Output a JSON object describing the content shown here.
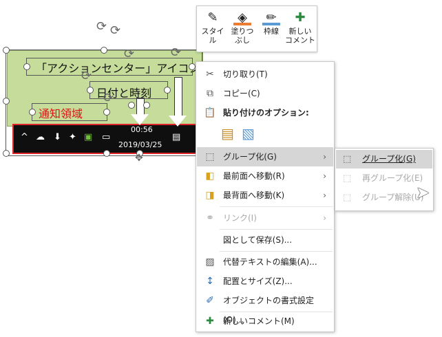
{
  "slide": {
    "action_center_label": "「アクションセンター」アイコン",
    "date_time_label": "日付と時刻",
    "notification_area_label": "通知領域",
    "taskbar_time": "00:56",
    "taskbar_date": "2019/03/25"
  },
  "mini_toolbar": {
    "style": "スタイル",
    "fill_line1": "塗りつ",
    "fill_line2": "ぶし",
    "outline": "枠線",
    "new_comment_line1": "新しい",
    "new_comment_line2": "コメント"
  },
  "menu": {
    "cut": "切り取り(T)",
    "copy": "コピー(C)",
    "paste_options": "貼り付けのオプション:",
    "group": "グループ化(G)",
    "bring_front": "最前面へ移動(R)",
    "send_back": "最背面へ移動(K)",
    "link": "リンク(I)",
    "save_as_picture": "図として保存(S)...",
    "alt_text": "代替テキストの編集(A)...",
    "size_position": "配置とサイズ(Z)...",
    "format_object": "オブジェクトの書式設定(O)...",
    "new_comment": "新しいコメント(M)"
  },
  "submenu": {
    "group": "グループ化(G)",
    "regroup": "再グループ化(E)",
    "ungroup": "グループ解除(U)"
  },
  "colors": {
    "slide_green": "#c5dc9a",
    "highlight": "#d6d6d6",
    "fill_orange": "#ed7d31",
    "outline_blue": "#5b9bd5",
    "notification_red": "#d11111"
  }
}
